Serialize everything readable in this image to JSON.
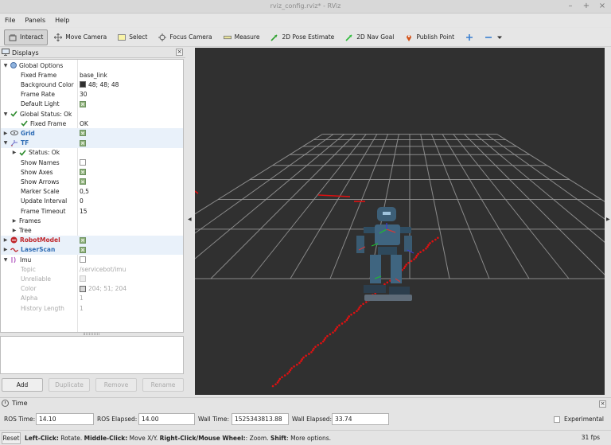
{
  "window": {
    "title": "rviz_config.rviz* - RViz",
    "controls": [
      "–",
      "+",
      "×"
    ]
  },
  "menu": [
    "File",
    "Panels",
    "Help"
  ],
  "toolbar": [
    {
      "label": "Interact",
      "icon": "interact-icon",
      "active": true
    },
    {
      "label": "Move Camera",
      "icon": "move-camera-icon"
    },
    {
      "label": "Select",
      "icon": "select-icon"
    },
    {
      "label": "Focus Camera",
      "icon": "focus-camera-icon"
    },
    {
      "label": "Measure",
      "icon": "measure-icon"
    },
    {
      "label": "2D Pose Estimate",
      "icon": "pose-estimate-icon"
    },
    {
      "label": "2D Nav Goal",
      "icon": "nav-goal-icon"
    },
    {
      "label": "Publish Point",
      "icon": "publish-point-icon"
    }
  ],
  "displays": {
    "title": "Displays",
    "rows": [
      {
        "name": "Global Options",
        "indent": 0,
        "arrow": "▼",
        "icon": "globe-icon",
        "style": ""
      },
      {
        "name": "Fixed Frame",
        "indent": 2,
        "value": "base_link"
      },
      {
        "name": "Background Color",
        "indent": 2,
        "value": "48; 48; 48",
        "swatch": "#303030"
      },
      {
        "name": "Frame Rate",
        "indent": 2,
        "value": "30"
      },
      {
        "name": "Default Light",
        "indent": 2,
        "check": "on"
      },
      {
        "name": "Global Status: Ok",
        "indent": 0,
        "arrow": "▼",
        "icon": "check-icon",
        "style": ""
      },
      {
        "name": "Fixed Frame",
        "indent": 2,
        "icon": "check-icon",
        "value": "OK"
      },
      {
        "name": "Grid",
        "indent": 0,
        "arrow": "▶",
        "icon": "grid-icon",
        "style": "blue",
        "check": "on",
        "hl": true
      },
      {
        "name": "TF",
        "indent": 0,
        "arrow": "▼",
        "icon": "tf-icon",
        "style": "blue",
        "check": "on",
        "hl": true
      },
      {
        "name": "Status: Ok",
        "indent": 1,
        "arrow": "▶",
        "icon": "check-icon"
      },
      {
        "name": "Show Names",
        "indent": 2,
        "check": "off"
      },
      {
        "name": "Show Axes",
        "indent": 2,
        "check": "on"
      },
      {
        "name": "Show Arrows",
        "indent": 2,
        "check": "on"
      },
      {
        "name": "Marker Scale",
        "indent": 2,
        "value": "0,5"
      },
      {
        "name": "Update Interval",
        "indent": 2,
        "value": "0"
      },
      {
        "name": "Frame Timeout",
        "indent": 2,
        "value": "15"
      },
      {
        "name": "Frames",
        "indent": 1,
        "arrow": "▶"
      },
      {
        "name": "Tree",
        "indent": 1,
        "arrow": "▶"
      },
      {
        "name": "RobotModel",
        "indent": 0,
        "arrow": "▶",
        "icon": "robot-model-icon",
        "style": "red",
        "check": "on",
        "hl": true
      },
      {
        "name": "LaserScan",
        "indent": 0,
        "arrow": "▶",
        "icon": "laser-scan-icon",
        "style": "blue",
        "check": "on",
        "hl": true
      },
      {
        "name": "Imu",
        "indent": 0,
        "arrow": "▼",
        "icon": "imu-icon",
        "check": "off"
      },
      {
        "name": "Topic",
        "indent": 2,
        "value": "/servicebot/imu",
        "dim": true
      },
      {
        "name": "Unreliable",
        "indent": 2,
        "check": "dis",
        "dim": true
      },
      {
        "name": "Color",
        "indent": 2,
        "value": "204; 51; 204",
        "swatch": "#d6d6d6",
        "dim": true
      },
      {
        "name": "Alpha",
        "indent": 2,
        "value": "1",
        "dim": true
      },
      {
        "name": "History Length",
        "indent": 2,
        "value": "1",
        "dim": true
      }
    ],
    "buttons": [
      {
        "label": "Add",
        "disabled": false
      },
      {
        "label": "Duplicate",
        "disabled": true
      },
      {
        "label": "Remove",
        "disabled": true
      },
      {
        "label": "Rename",
        "disabled": true
      }
    ]
  },
  "time": {
    "title": "Time",
    "ros_time_label": "ROS Time:",
    "ros_time": "14.10",
    "ros_elapsed_label": "ROS Elapsed:",
    "ros_elapsed": "14.00",
    "wall_time_label": "Wall Time:",
    "wall_time": "1525343813.88",
    "wall_elapsed_label": "Wall Elapsed:",
    "wall_elapsed": "33.74",
    "experimental_label": "Experimental"
  },
  "status": {
    "reset_label": "Reset",
    "hint": [
      {
        "b": "Left-Click:",
        "t": " Rotate. "
      },
      {
        "b": "Middle-Click:",
        "t": " Move X/Y. "
      },
      {
        "b": "Right-Click/Mouse Wheel:",
        "t": ": Zoom. "
      },
      {
        "b": "Shift",
        "t": ": More options."
      }
    ],
    "fps": "31 fps"
  },
  "colors": {
    "grid": "#9a9a9a",
    "laser": "#e01010",
    "background": "#303030"
  }
}
